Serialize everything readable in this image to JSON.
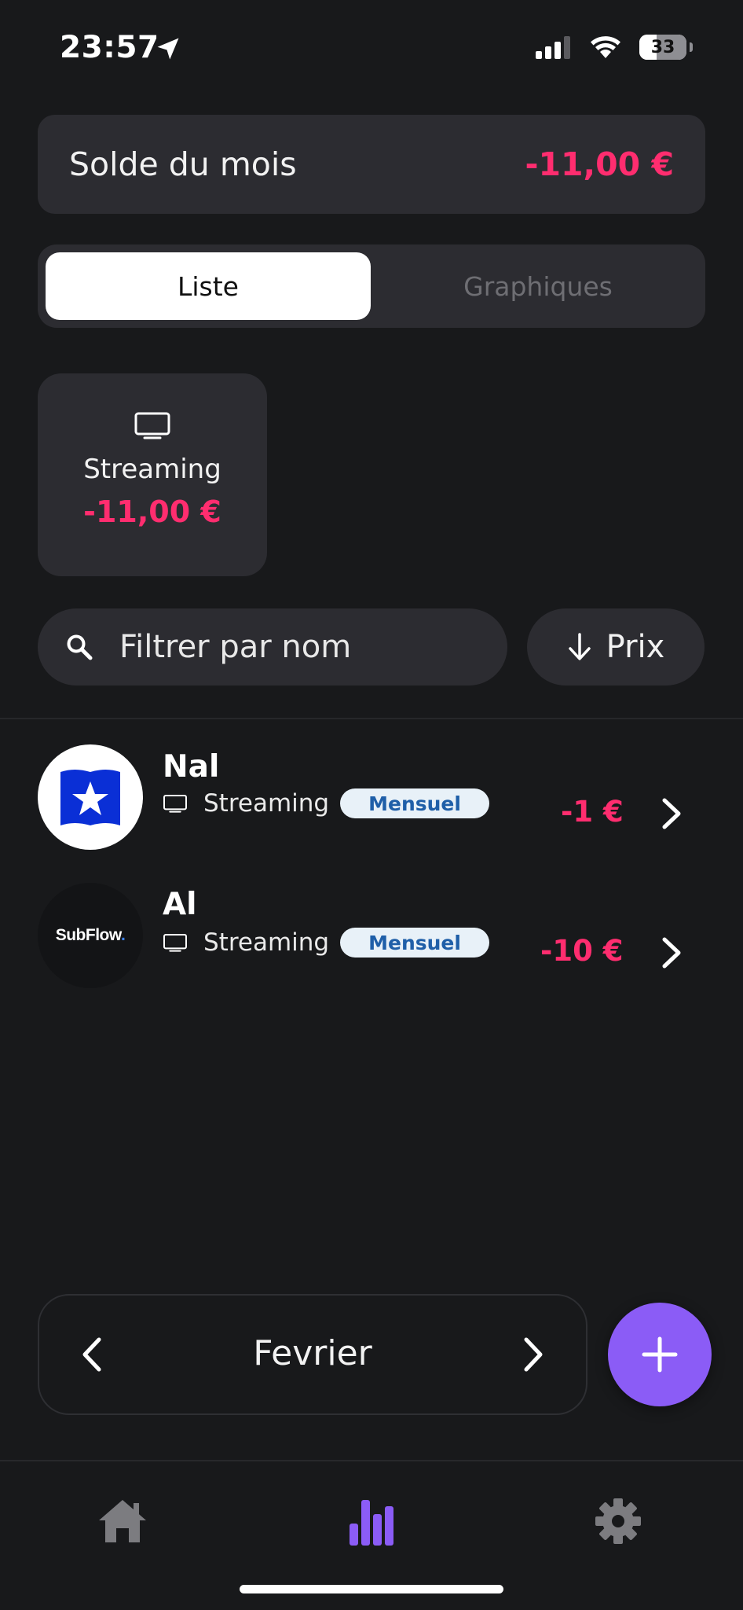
{
  "status_bar": {
    "time": "23:57",
    "battery": "33"
  },
  "balance": {
    "label": "Solde du mois",
    "value": "-11,00 €"
  },
  "view_toggle": {
    "list_label": "Liste",
    "charts_label": "Graphiques",
    "selected": "Liste"
  },
  "category_summary": {
    "icon": "tv-icon",
    "name": "Streaming",
    "amount": "-11,00 €"
  },
  "filter": {
    "search_placeholder": "Filtrer par nom",
    "sort_label": "Prix",
    "sort_icon": "arrow-down-icon"
  },
  "subscriptions": [
    {
      "name": "Nal",
      "category": "Streaming",
      "frequency": "Mensuel",
      "amount": "-1 €",
      "logo": "blue-book-star-logo"
    },
    {
      "name": "Al",
      "category": "Streaming",
      "frequency": "Mensuel",
      "amount": "-10 €",
      "logo": "subflow-logo",
      "logo_text": "SubFlow."
    }
  ],
  "month_selector": {
    "month": "Fevrier"
  },
  "tabbar": {
    "items": [
      "home-icon",
      "chart-bar-icon",
      "gear-icon"
    ],
    "active": "chart-bar-icon"
  },
  "colors": {
    "background": "#18191b",
    "card": "#2c2c31",
    "negative_amount": "#ff2d6f",
    "accent": "#8b5cf6",
    "badge_bg": "#e8f1f8",
    "badge_text": "#1f5fa8"
  }
}
